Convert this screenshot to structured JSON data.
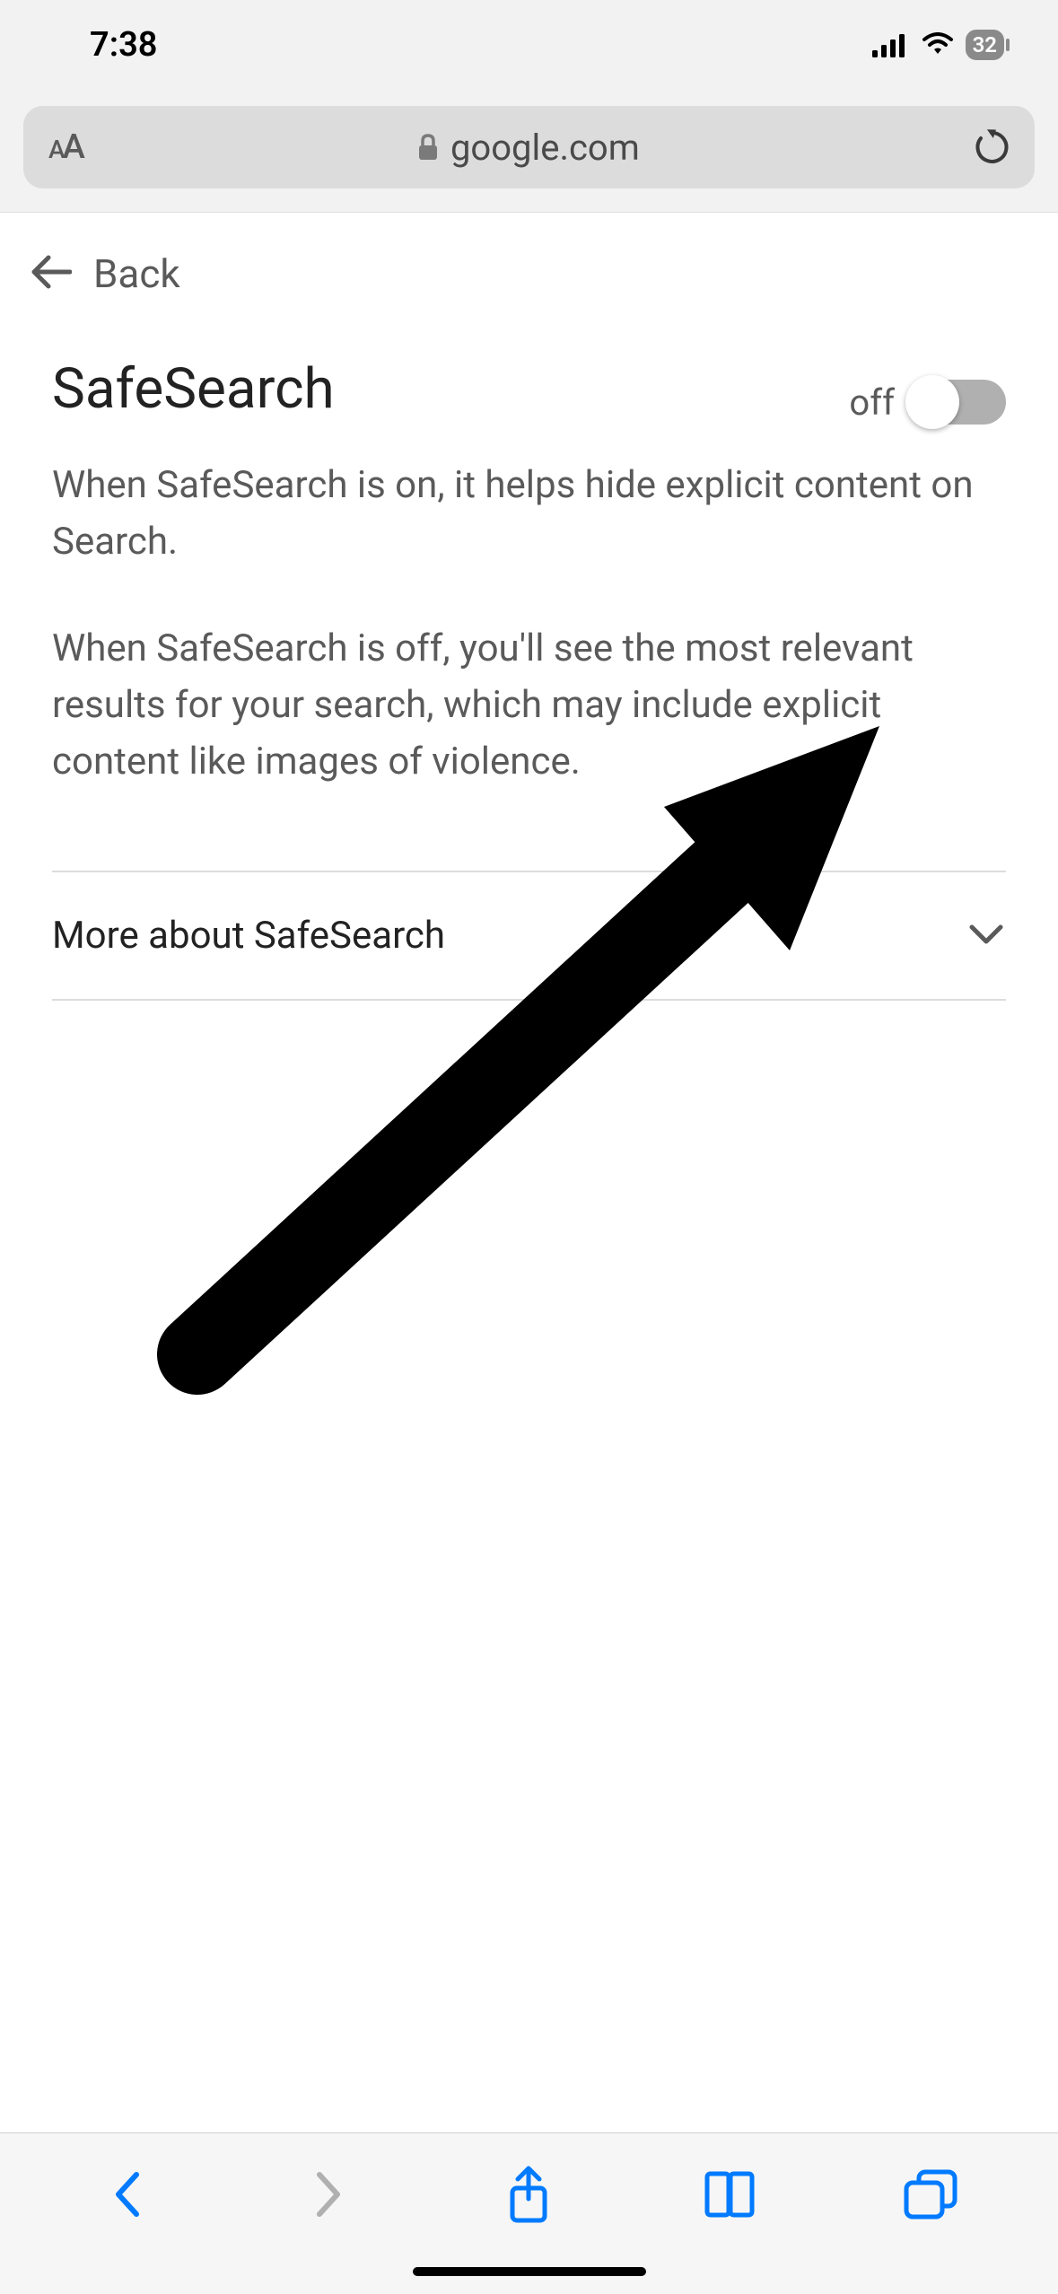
{
  "status": {
    "time": "7:38",
    "battery": "32"
  },
  "urlbar": {
    "domain": "google.com"
  },
  "page": {
    "back_label": "Back",
    "title": "SafeSearch",
    "toggle_state": "off",
    "desc1": "When SafeSearch is on, it helps hide explicit content on Search.",
    "desc2": "When SafeSearch is off, you'll see the most relevant results for your search, which may include explicit content like images of violence.",
    "more_label": "More about SafeSearch"
  }
}
